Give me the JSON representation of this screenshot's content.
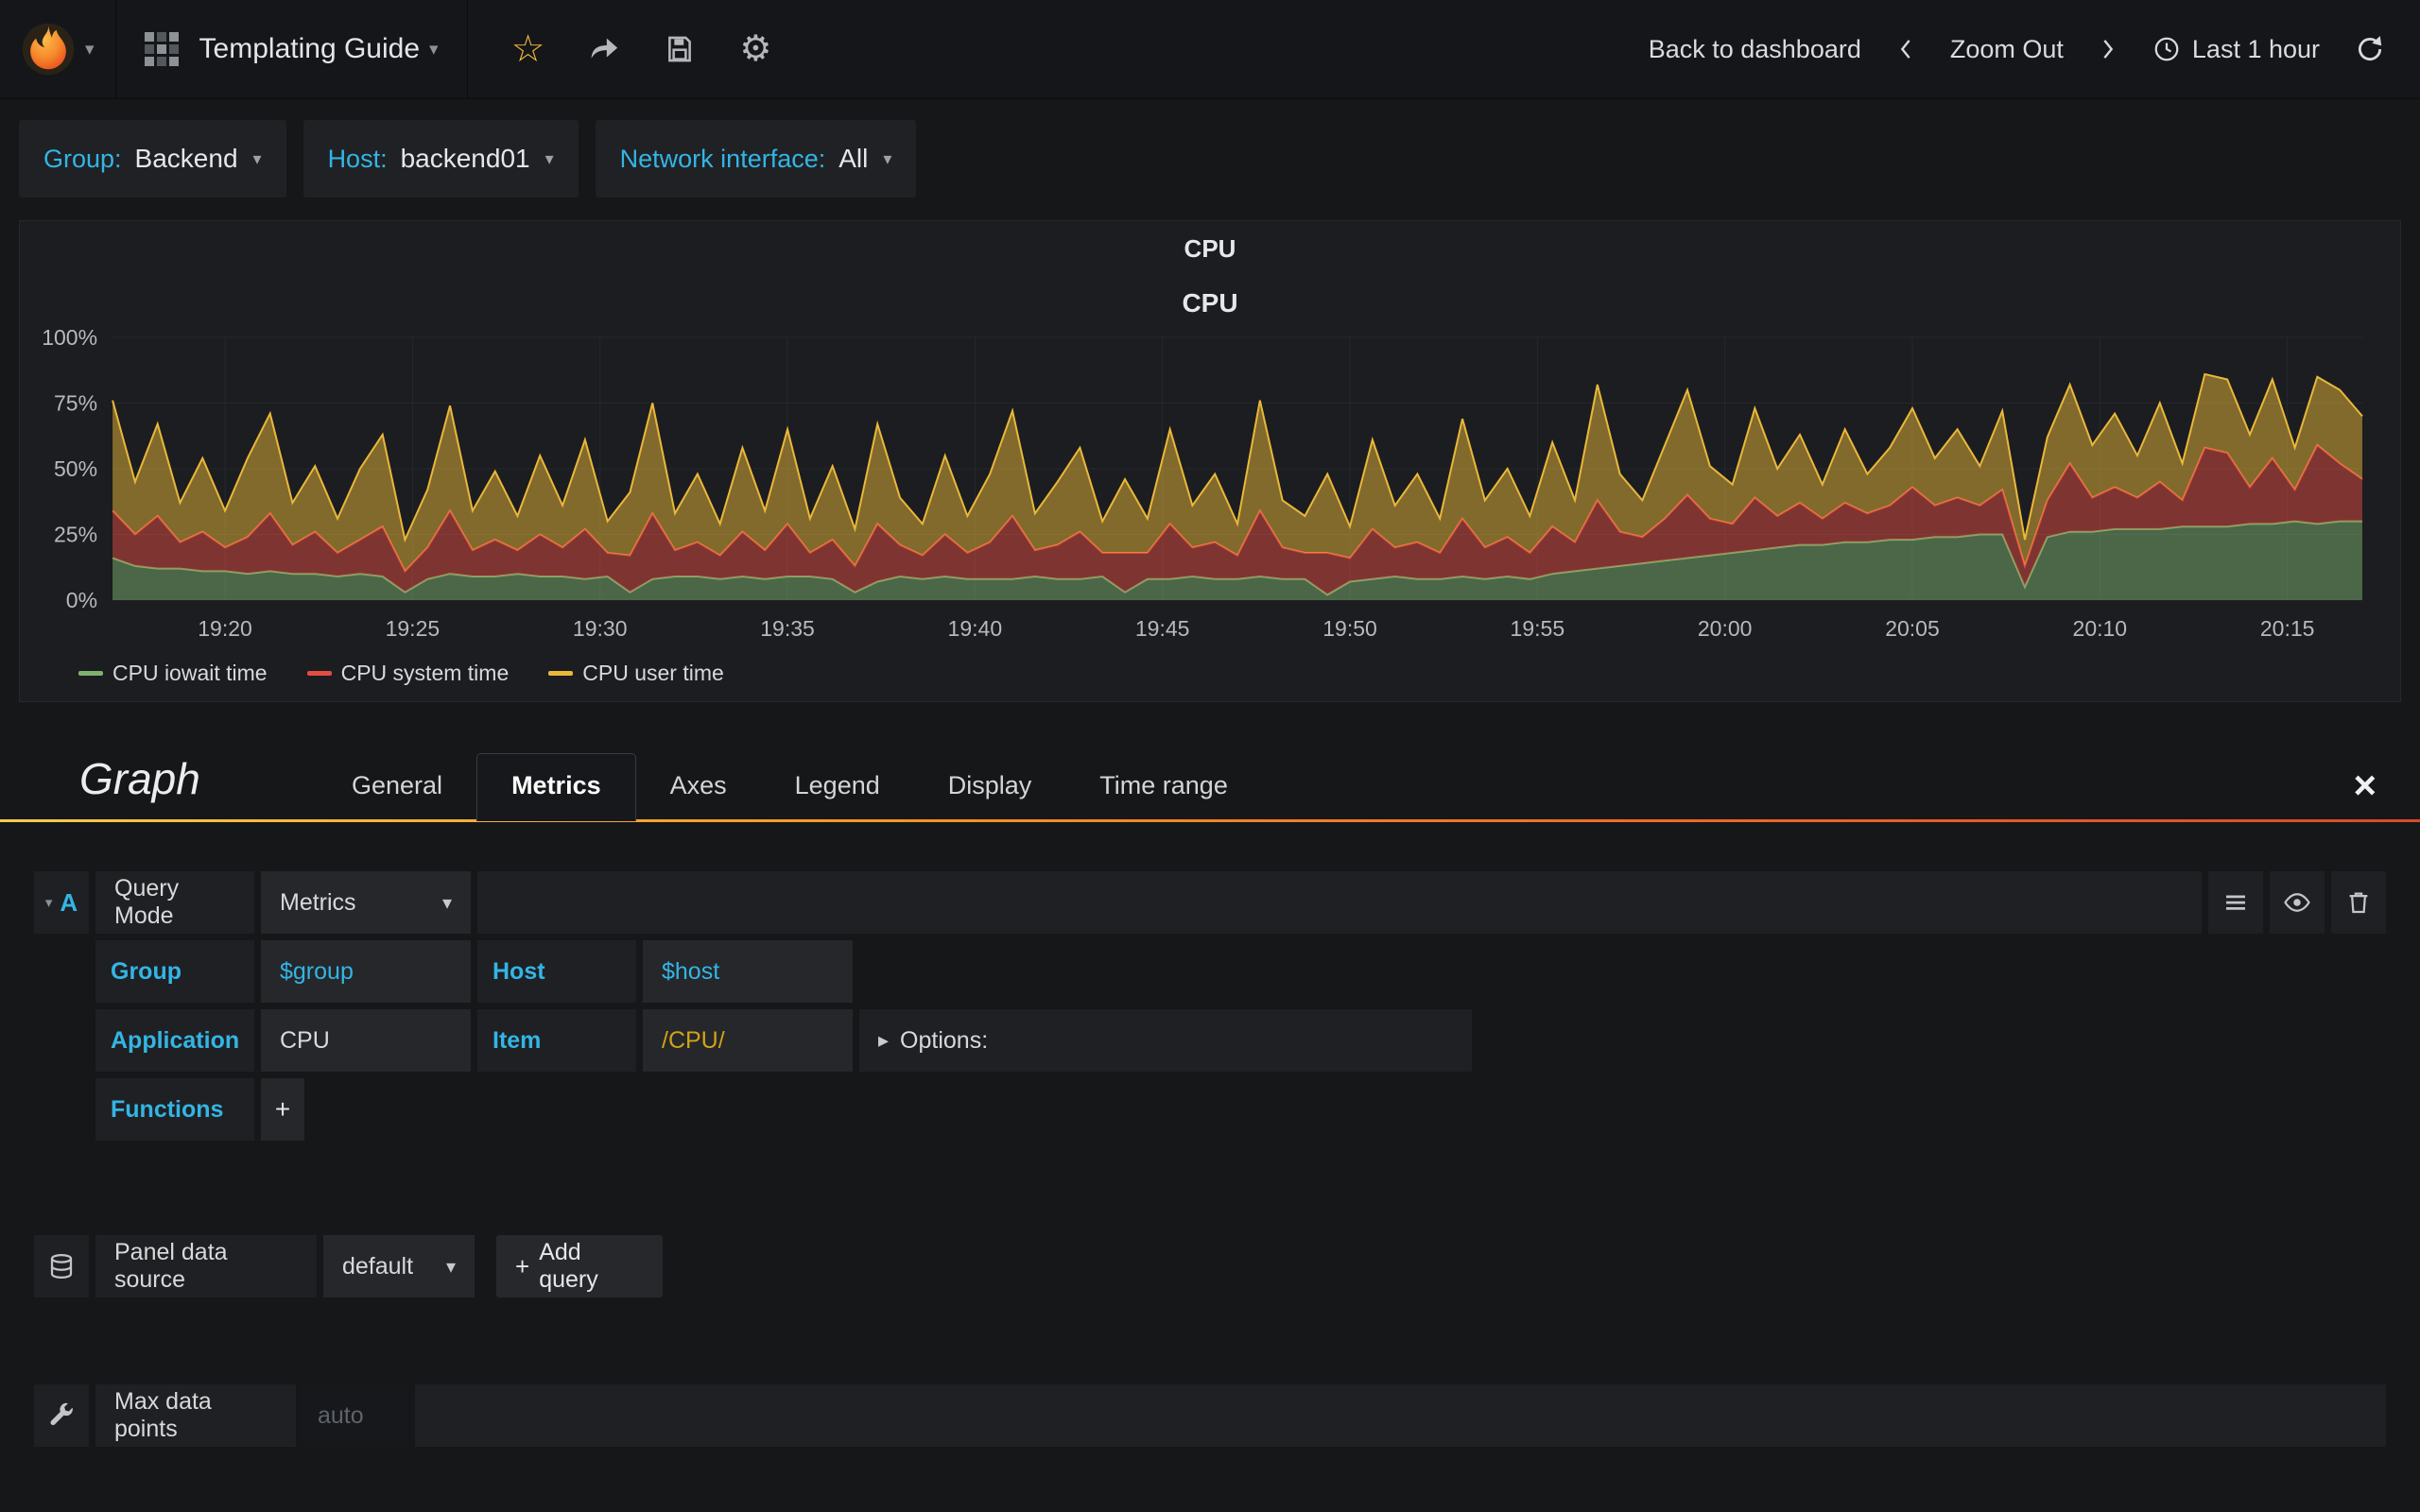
{
  "navbar": {
    "title": "Templating Guide",
    "back_to_dashboard": "Back to dashboard",
    "zoom_out": "Zoom Out",
    "time_range": "Last 1 hour"
  },
  "template_vars": [
    {
      "label": "Group:",
      "value": "Backend"
    },
    {
      "label": "Host:",
      "value": "backend01"
    },
    {
      "label": "Network interface:",
      "value": "All"
    }
  ],
  "panel": {
    "title": "CPU"
  },
  "chart_data": {
    "type": "area",
    "stacked": true,
    "title": "CPU",
    "xlabel": "",
    "ylabel": "",
    "ylim": [
      0,
      100
    ],
    "grid": true,
    "legend_position": "bottom-left",
    "y_ticks": [
      0,
      25,
      50,
      75,
      100
    ],
    "y_tick_labels": [
      "0%",
      "25%",
      "50%",
      "75%",
      "100%"
    ],
    "x_start": "19:17",
    "x_end": "20:17",
    "x_ticks": [
      {
        "min": 3,
        "label": "19:20"
      },
      {
        "min": 8,
        "label": "19:25"
      },
      {
        "min": 13,
        "label": "19:30"
      },
      {
        "min": 18,
        "label": "19:35"
      },
      {
        "min": 23,
        "label": "19:40"
      },
      {
        "min": 28,
        "label": "19:45"
      },
      {
        "min": 33,
        "label": "19:50"
      },
      {
        "min": 38,
        "label": "19:55"
      },
      {
        "min": 43,
        "label": "20:00"
      },
      {
        "min": 48,
        "label": "20:05"
      },
      {
        "min": 53,
        "label": "20:10"
      },
      {
        "min": 58,
        "label": "20:15"
      }
    ],
    "series": [
      {
        "name": "CPU iowait time",
        "color": "#7EB26D",
        "values": [
          16,
          13,
          12,
          12,
          11,
          11,
          10,
          11,
          10,
          10,
          9,
          10,
          9,
          3,
          8,
          10,
          9,
          9,
          10,
          9,
          9,
          8,
          9,
          3,
          8,
          9,
          9,
          8,
          9,
          8,
          9,
          9,
          8,
          3,
          7,
          9,
          8,
          9,
          8,
          8,
          8,
          9,
          8,
          8,
          9,
          3,
          8,
          8,
          9,
          8,
          8,
          9,
          8,
          8,
          2,
          7,
          8,
          9,
          8,
          8,
          9,
          8,
          9,
          8,
          10,
          11,
          12,
          13,
          14,
          15,
          16,
          17,
          18,
          19,
          20,
          21,
          21,
          22,
          22,
          23,
          23,
          24,
          24,
          25,
          25,
          5,
          24,
          26,
          26,
          27,
          27,
          27,
          28,
          28,
          28,
          29,
          29,
          30,
          29,
          30,
          30
        ]
      },
      {
        "name": "CPU system time",
        "color": "#E24D42",
        "values": [
          18,
          12,
          20,
          10,
          15,
          9,
          14,
          22,
          11,
          16,
          9,
          13,
          19,
          8,
          12,
          24,
          10,
          14,
          9,
          16,
          11,
          19,
          9,
          14,
          25,
          10,
          13,
          9,
          17,
          11,
          20,
          9,
          15,
          10,
          22,
          12,
          9,
          16,
          10,
          14,
          24,
          10,
          13,
          18,
          9,
          15,
          10,
          21,
          11,
          14,
          9,
          25,
          12,
          10,
          16,
          9,
          19,
          11,
          14,
          10,
          22,
          12,
          15,
          10,
          18,
          11,
          26,
          13,
          10,
          16,
          24,
          14,
          11,
          20,
          12,
          16,
          10,
          15,
          11,
          13,
          20,
          12,
          15,
          11,
          17,
          8,
          14,
          26,
          13,
          16,
          12,
          18,
          10,
          30,
          28,
          14,
          25,
          12,
          30,
          22,
          16
        ]
      },
      {
        "name": "CPU user time",
        "color": "#EAB839",
        "values": [
          42,
          20,
          35,
          15,
          28,
          14,
          30,
          38,
          16,
          25,
          13,
          27,
          35,
          12,
          22,
          40,
          15,
          26,
          13,
          30,
          16,
          34,
          12,
          24,
          42,
          14,
          26,
          12,
          32,
          15,
          36,
          13,
          28,
          14,
          38,
          18,
          12,
          30,
          14,
          26,
          40,
          14,
          24,
          32,
          12,
          28,
          13,
          36,
          16,
          26,
          12,
          42,
          18,
          14,
          30,
          12,
          34,
          16,
          26,
          13,
          38,
          18,
          26,
          14,
          32,
          16,
          44,
          22,
          14,
          28,
          40,
          20,
          15,
          34,
          18,
          26,
          13,
          28,
          15,
          22,
          30,
          18,
          26,
          15,
          30,
          10,
          24,
          30,
          20,
          28,
          16,
          30,
          14,
          28,
          28,
          20,
          30,
          16,
          26,
          28,
          24
        ]
      }
    ]
  },
  "editor": {
    "panel_type": "Graph",
    "tabs": [
      "General",
      "Metrics",
      "Axes",
      "Legend",
      "Display",
      "Time range"
    ],
    "active_tab": "Metrics",
    "query": {
      "letter": "A",
      "mode_label": "Query Mode",
      "mode_value": "Metrics",
      "group_label": "Group",
      "group_value": "$group",
      "host_label": "Host",
      "host_value": "$host",
      "application_label": "Application",
      "application_value": "CPU",
      "item_label": "Item",
      "item_value": "/CPU/",
      "options_label": "Options:",
      "functions_label": "Functions"
    },
    "datasource": {
      "label": "Panel data source",
      "value": "default",
      "add_query": "Add query"
    },
    "max_data_points": {
      "label": "Max data points",
      "placeholder": "auto"
    }
  },
  "icons": {
    "caret_down": "▾",
    "options_caret": "▸",
    "star": "☆",
    "gear": "⚙",
    "close": "×",
    "plus": "+"
  },
  "colors": {
    "accent_blue": "#33b5e5",
    "item_value_gold": "#cfa315",
    "star_orange": "#f6b93d",
    "tab_gradient": [
      "#ffca4f",
      "#ea5c29"
    ]
  }
}
